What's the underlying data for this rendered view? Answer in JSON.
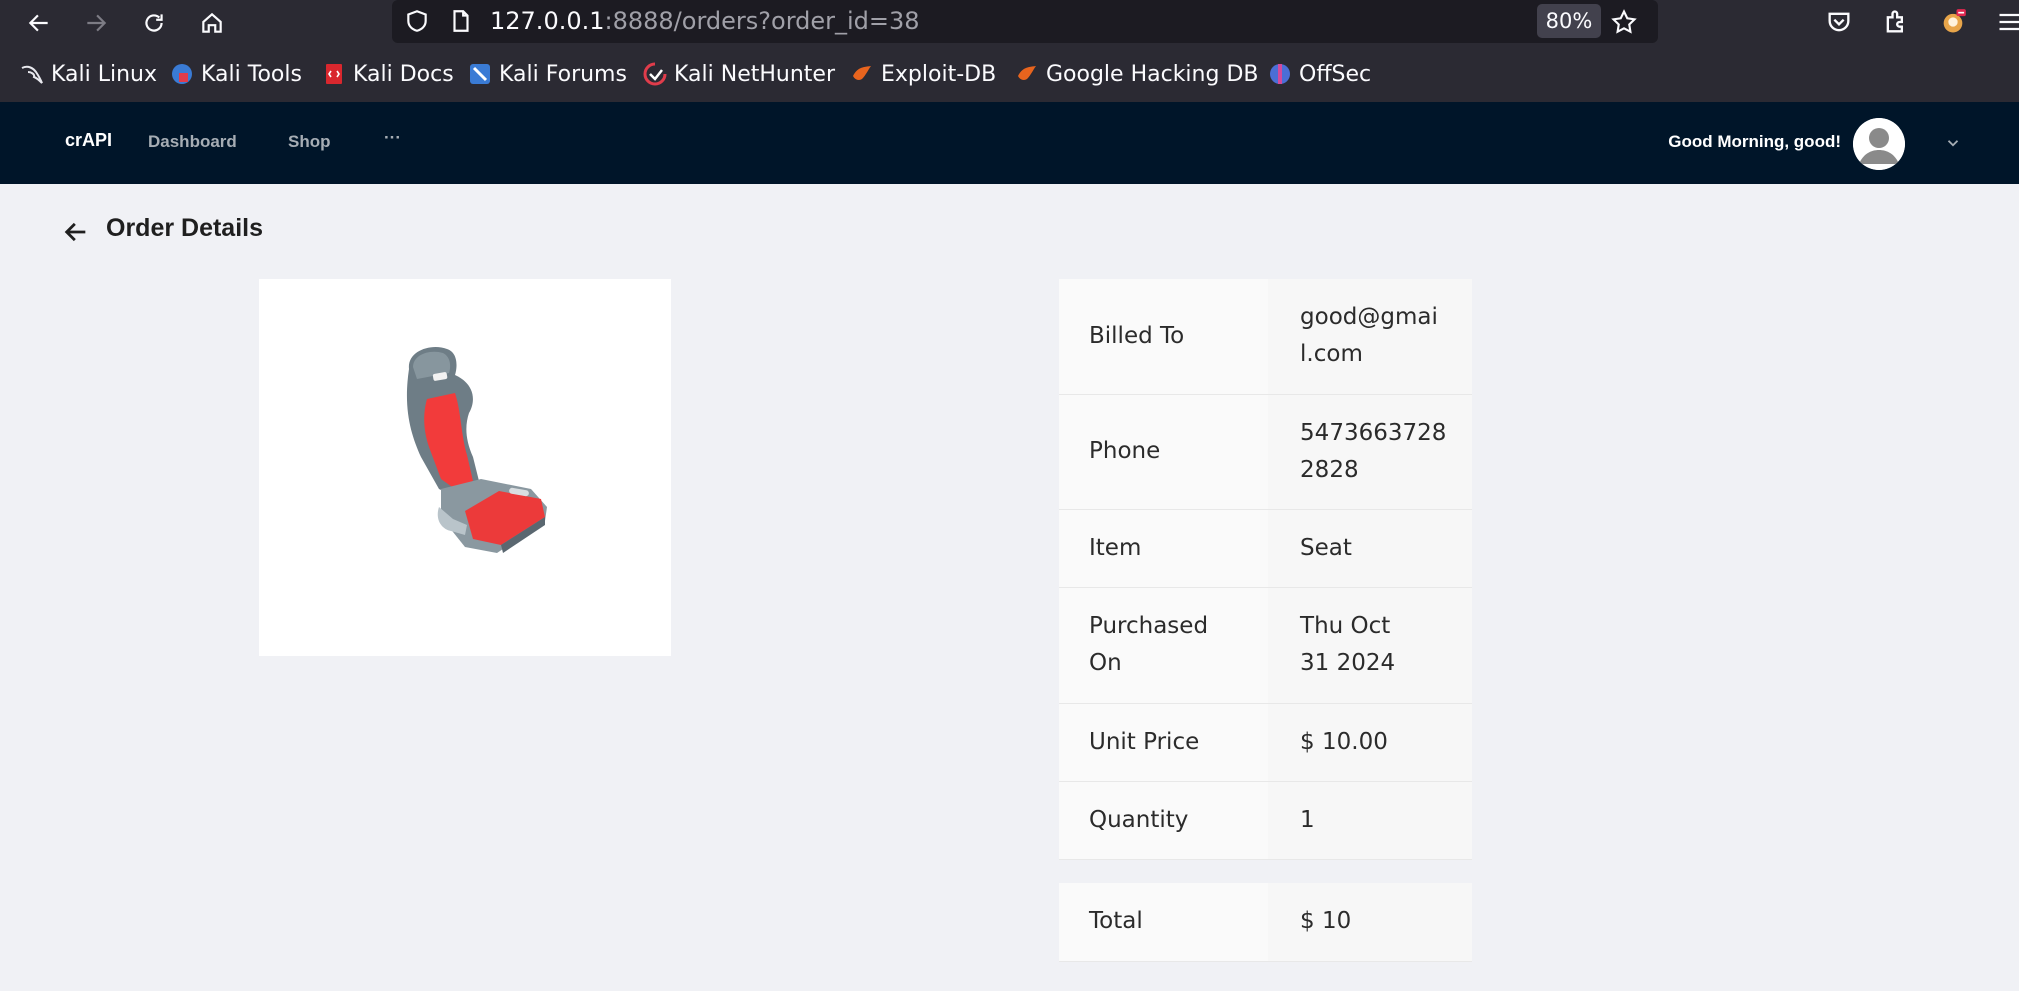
{
  "browser": {
    "url_host": "127.0.0.1",
    "url_rest": ":8888/orders?order_id=38",
    "zoom": "80%",
    "bookmarks": [
      {
        "label": "Kali Linux",
        "icon": "kali-dragon-icon"
      },
      {
        "label": "Kali Tools",
        "icon": "kali-tools-icon"
      },
      {
        "label": "Kali Docs",
        "icon": "kali-docs-icon"
      },
      {
        "label": "Kali Forums",
        "icon": "kali-forums-icon"
      },
      {
        "label": "Kali NetHunter",
        "icon": "kali-nethunter-icon"
      },
      {
        "label": "Exploit-DB",
        "icon": "exploit-db-icon"
      },
      {
        "label": "Google Hacking DB",
        "icon": "ghdb-icon"
      },
      {
        "label": "OffSec",
        "icon": "offsec-icon"
      }
    ]
  },
  "app": {
    "brand": "crAPI",
    "menu": [
      "Dashboard",
      "Shop",
      "···"
    ],
    "greeting": "Good Morning, good!"
  },
  "page": {
    "title": "Order Details",
    "product_image": "car-seat-image"
  },
  "order": {
    "billed_to_label": "Billed To",
    "billed_to": "good@gmail.com",
    "phone_label": "Phone",
    "phone": "54736637282828",
    "item_label": "Item",
    "item": "Seat",
    "purchased_on_label": "Purchased On",
    "purchased_on": "Thu Oct 31 2024",
    "unit_price_label": "Unit Price",
    "unit_price": "$ 10.00",
    "quantity_label": "Quantity",
    "quantity": "1",
    "total_label": "Total",
    "total": "$ 10"
  },
  "colors": {
    "header_bg": "#001529",
    "content_bg": "#f0f1f5",
    "browser_chrome": "#2b2a33"
  }
}
